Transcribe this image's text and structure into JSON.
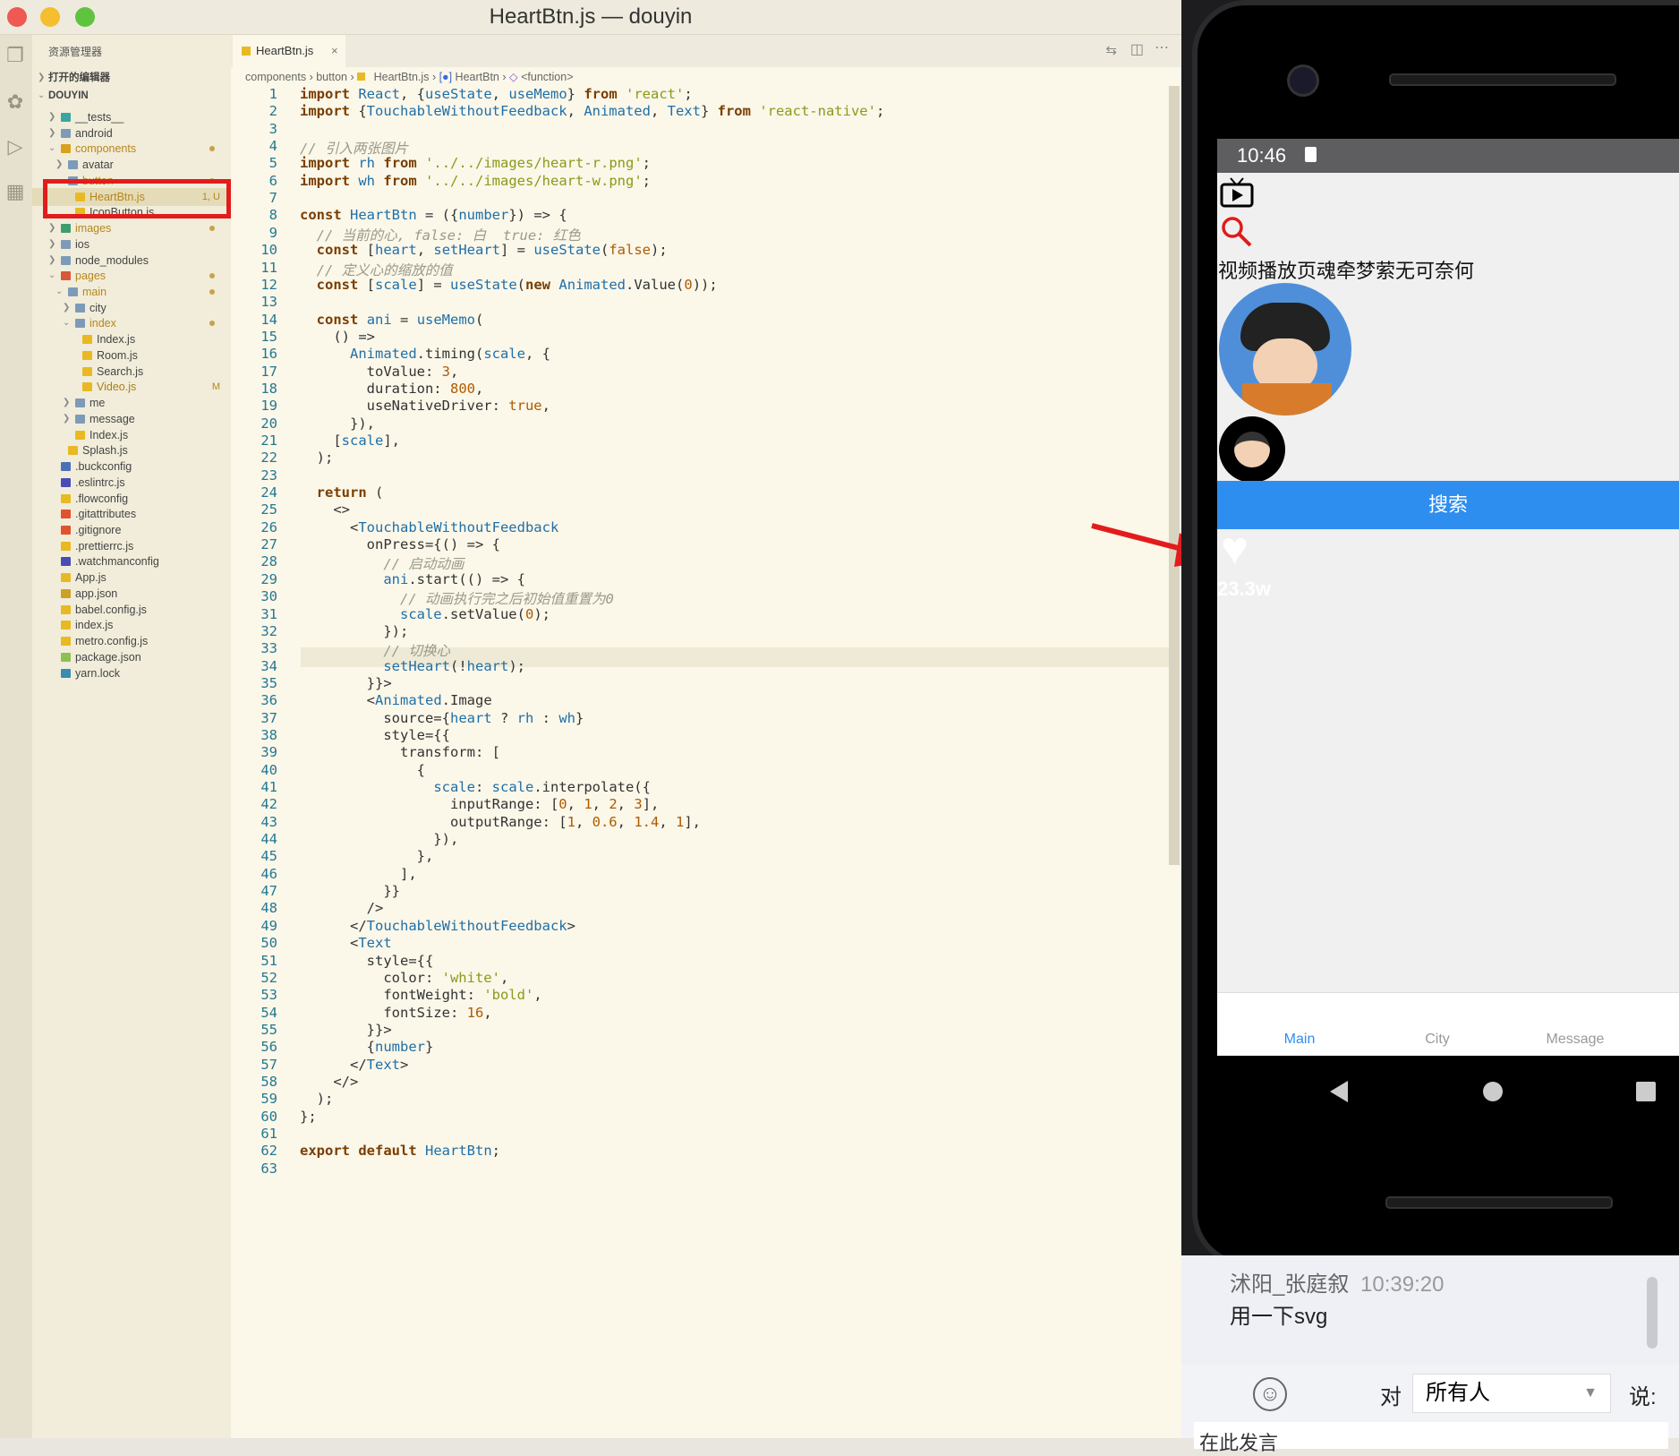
{
  "window": {
    "title": "HeartBtn.js — douyin"
  },
  "sidebar": {
    "title": "资源管理器",
    "open_editors": "打开的编辑器",
    "project": "DOUYIN",
    "items": [
      {
        "label": "__tests__",
        "depth": 1,
        "icon": "teal-folder"
      },
      {
        "label": "android",
        "depth": 1,
        "icon": "folder"
      },
      {
        "label": "components",
        "depth": 1,
        "icon": "yellow-folder",
        "dot": true
      },
      {
        "label": "avatar",
        "depth": 2,
        "icon": "folder"
      },
      {
        "label": "button",
        "depth": 2,
        "icon": "folder",
        "dot": true
      },
      {
        "label": "HeartBtn.js",
        "depth": 3,
        "icon": "js",
        "badge": "1, U"
      },
      {
        "label": "IconButton.js",
        "depth": 3,
        "icon": "js"
      },
      {
        "label": "images",
        "depth": 1,
        "icon": "image-folder",
        "dot": true
      },
      {
        "label": "ios",
        "depth": 1,
        "icon": "folder"
      },
      {
        "label": "node_modules",
        "depth": 1,
        "icon": "folder"
      },
      {
        "label": "pages",
        "depth": 1,
        "icon": "red-folder",
        "dot": true
      },
      {
        "label": "main",
        "depth": 2,
        "icon": "folder",
        "dot": true
      },
      {
        "label": "city",
        "depth": 3,
        "icon": "folder"
      },
      {
        "label": "index",
        "depth": 3,
        "icon": "folder",
        "dot": true
      },
      {
        "label": "Index.js",
        "depth": 4,
        "icon": "js"
      },
      {
        "label": "Room.js",
        "depth": 4,
        "icon": "js"
      },
      {
        "label": "Search.js",
        "depth": 4,
        "icon": "js"
      },
      {
        "label": "Video.js",
        "depth": 4,
        "icon": "js",
        "badge": "M"
      },
      {
        "label": "me",
        "depth": 3,
        "icon": "folder"
      },
      {
        "label": "message",
        "depth": 3,
        "icon": "folder"
      },
      {
        "label": "Index.js",
        "depth": 3,
        "icon": "js"
      },
      {
        "label": "Splash.js",
        "depth": 2,
        "icon": "js"
      },
      {
        "label": ".buckconfig",
        "depth": 1,
        "icon": "config"
      },
      {
        "label": ".eslintrc.js",
        "depth": 1,
        "icon": "eslint"
      },
      {
        "label": ".flowconfig",
        "depth": 1,
        "icon": "flow"
      },
      {
        "label": ".gitattributes",
        "depth": 1,
        "icon": "git"
      },
      {
        "label": ".gitignore",
        "depth": 1,
        "icon": "git"
      },
      {
        "label": ".prettierrc.js",
        "depth": 1,
        "icon": "js"
      },
      {
        "label": ".watchmanconfig",
        "depth": 1,
        "icon": "eslint"
      },
      {
        "label": "App.js",
        "depth": 1,
        "icon": "js"
      },
      {
        "label": "app.json",
        "depth": 1,
        "icon": "json"
      },
      {
        "label": "babel.config.js",
        "depth": 1,
        "icon": "js"
      },
      {
        "label": "index.js",
        "depth": 1,
        "icon": "js"
      },
      {
        "label": "metro.config.js",
        "depth": 1,
        "icon": "js"
      },
      {
        "label": "package.json",
        "depth": 1,
        "icon": "npm"
      },
      {
        "label": "yarn.lock",
        "depth": 1,
        "icon": "yarn"
      }
    ]
  },
  "editor": {
    "tab": "HeartBtn.js",
    "breadcrumb": [
      "components",
      "button",
      "HeartBtn.js",
      "HeartBtn",
      "<function>"
    ],
    "lines": [
      "import React, {useState, useMemo} from 'react';",
      "import {TouchableWithoutFeedback, Animated, Text} from 'react-native';",
      "",
      "// 引入两张图片",
      "import rh from '../../images/heart-r.png';",
      "import wh from '../../images/heart-w.png';",
      "",
      "const HeartBtn = ({number}) => {",
      "  // 当前的心, false: 白  true: 红色",
      "  const [heart, setHeart] = useState(false);",
      "  // 定义心的缩放的值",
      "  const [scale] = useState(new Animated.Value(0));",
      "",
      "  const ani = useMemo(",
      "    () =>",
      "      Animated.timing(scale, {",
      "        toValue: 3,",
      "        duration: 800,",
      "        useNativeDriver: true,",
      "      }),",
      "    [scale],",
      "  );",
      "",
      "  return (",
      "    <>",
      "      <TouchableWithoutFeedback",
      "        onPress={() => {",
      "          // 启动动画",
      "          ani.start(() => {",
      "            // 动画执行完之后初始值重置为0",
      "            scale.setValue(0);",
      "          });",
      "          // 切换心",
      "          setHeart(!heart);",
      "        }}>",
      "        <Animated.Image",
      "          source={heart ? rh : wh}",
      "          style={{",
      "            transform: [",
      "              {",
      "                scale: scale.interpolate({",
      "                  inputRange: [0, 1, 2, 3],",
      "                  outputRange: [1, 0.6, 1.4, 1],",
      "                }),",
      "              },",
      "            ],",
      "          }}",
      "        />",
      "      </TouchableWithoutFeedback>",
      "      <Text",
      "        style={{",
      "          color: 'white',",
      "          fontWeight: 'bold',",
      "          fontSize: 16,",
      "        }}>",
      "        {number}",
      "      </Text>",
      "    </>",
      "  );",
      "};",
      "",
      "export default HeartBtn;",
      ""
    ]
  },
  "phone": {
    "time": "10:46",
    "page_title": "视频播放页魂牵梦萦无可奈何",
    "search_button": "搜索",
    "heart_count": "23.3w",
    "tabs": [
      "Main",
      "City",
      "Message"
    ]
  },
  "chat": {
    "user": "沭阳_张庭叙",
    "time": "10:39:20",
    "message": "用一下svg",
    "to_label": "对",
    "to_value": "所有人",
    "say_label": "说:",
    "cut_text": "在此发言"
  },
  "colors": {
    "accent_blue": "#2e8ef0",
    "annotation_red": "#e21c1c",
    "tab_active": "#2e8ef0"
  }
}
